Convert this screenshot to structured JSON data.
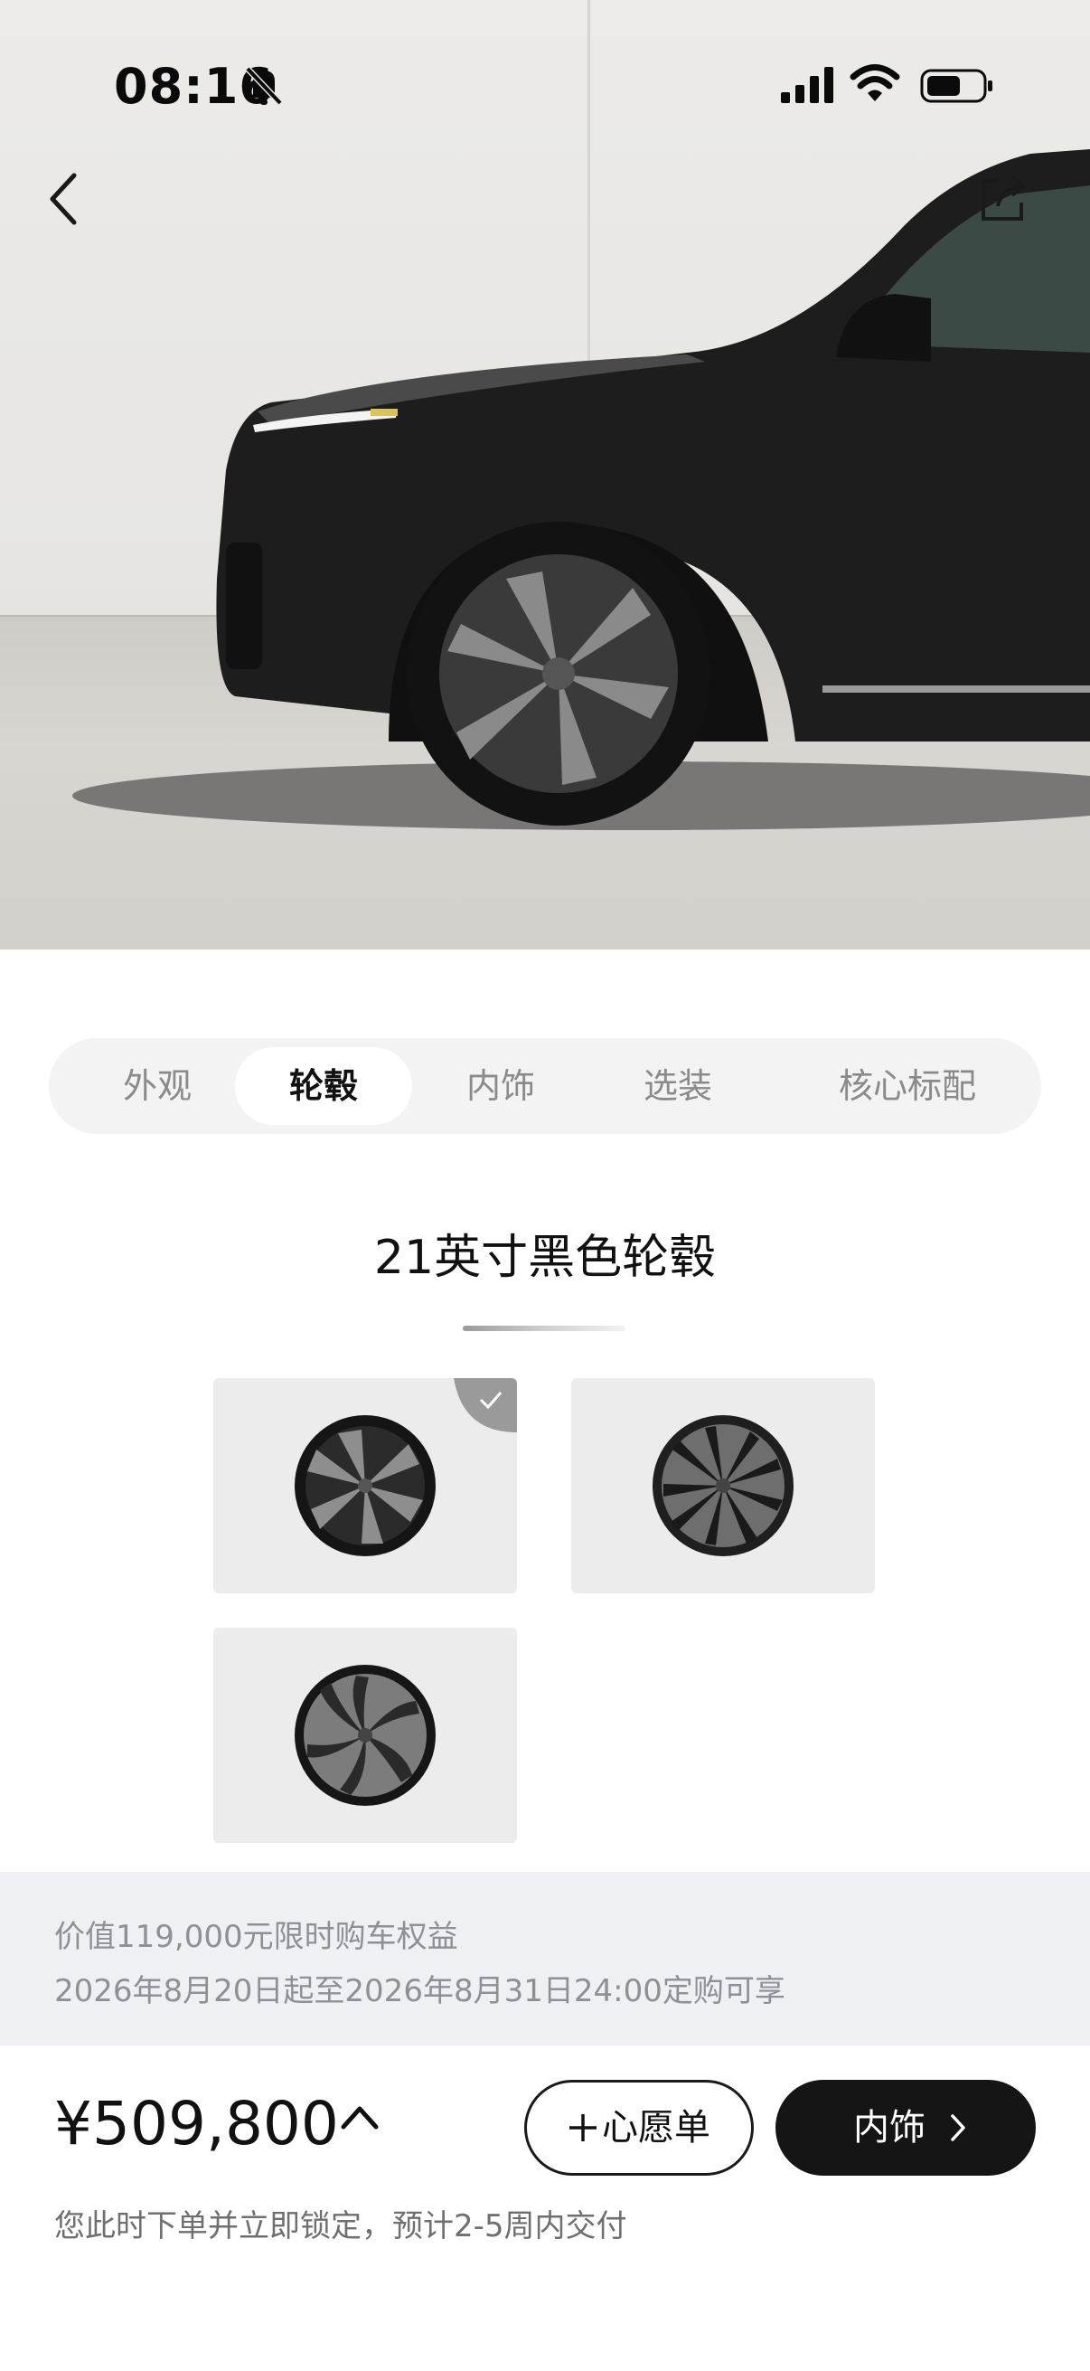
{
  "status_bar": {
    "time": "08:16"
  },
  "tabs": [
    {
      "label": "外观",
      "active": false
    },
    {
      "label": "轮毂",
      "active": true
    },
    {
      "label": "内饰",
      "active": false
    },
    {
      "label": "选装",
      "active": false
    },
    {
      "label": "核心标配",
      "active": false
    }
  ],
  "section": {
    "title": "21英寸黑色轮毂"
  },
  "wheel_options": [
    {
      "selected": true
    },
    {
      "selected": false
    },
    {
      "selected": false
    }
  ],
  "promo": {
    "line1": "价值119,000元限时购车权益",
    "line2": "2026年8月20日起至2026年8月31日24:00定购可享"
  },
  "footer": {
    "price": "¥509,800",
    "delivery_note": "您此时下单并立即锁定，预计2-5周内交付",
    "wishlist_label": "心愿单",
    "next_label": "内饰"
  },
  "icons": [
    "back-icon",
    "share-icon",
    "bell-muted-icon",
    "signal-icon",
    "wifi-icon",
    "battery-icon",
    "checkmark-icon",
    "chevron-up-icon",
    "plus-icon",
    "chevron-right-icon"
  ],
  "colors": {
    "primary_button": "#151515",
    "tab_track": "#f3f3f3",
    "promo_bg": "#eef0f4"
  }
}
